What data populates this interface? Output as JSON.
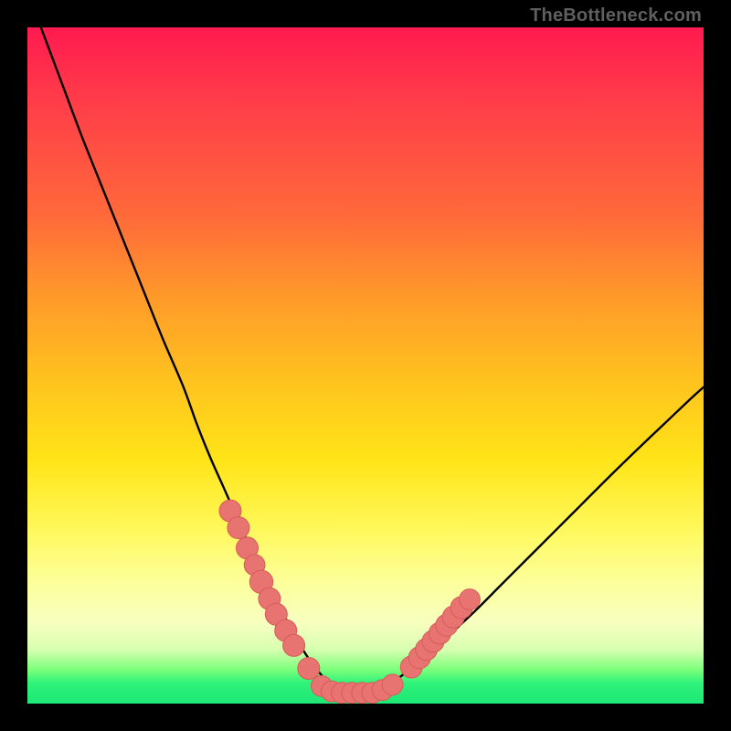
{
  "attribution": "TheBottleneck.com",
  "colors": {
    "curve": "#000000",
    "scatter_fill": "#e77471",
    "scatter_stroke": "#d85b58",
    "frame": "#000000"
  },
  "chart_data": {
    "type": "line",
    "title": "",
    "xlabel": "",
    "ylabel": "",
    "xlim": [
      0,
      100
    ],
    "ylim": [
      0,
      100
    ],
    "grid": false,
    "legend": false,
    "series": [
      {
        "name": "bottleneck-curve",
        "x": [
          2,
          5,
          8,
          11,
          14,
          17,
          20,
          23,
          25,
          27,
          29,
          31,
          33,
          35,
          37,
          38.5,
          40,
          41.5,
          43,
          45,
          47,
          50,
          53,
          56,
          59,
          62,
          66,
          70,
          74,
          78,
          82,
          86,
          90,
          94,
          98,
          100
        ],
        "values": [
          100,
          92,
          84,
          76.5,
          69,
          61.5,
          54,
          47,
          41.5,
          36.5,
          32,
          27.5,
          23,
          19,
          15,
          12,
          9.2,
          6.8,
          4.8,
          2.6,
          1.6,
          1.6,
          2.6,
          4.6,
          7.0,
          9.8,
          13.5,
          17.5,
          21.5,
          25.5,
          29.5,
          33.5,
          37.4,
          41.2,
          45.0,
          46.8
        ]
      }
    ],
    "scatter": {
      "name": "highlighted-points",
      "points": [
        {
          "x": 30.0,
          "y": 28.5,
          "r": 1.2
        },
        {
          "x": 31.2,
          "y": 26.0,
          "r": 1.2
        },
        {
          "x": 32.5,
          "y": 23.0,
          "r": 1.2
        },
        {
          "x": 33.6,
          "y": 20.5,
          "r": 1.1
        },
        {
          "x": 34.6,
          "y": 18.0,
          "r": 1.3
        },
        {
          "x": 35.8,
          "y": 15.5,
          "r": 1.2
        },
        {
          "x": 36.8,
          "y": 13.2,
          "r": 1.2
        },
        {
          "x": 38.2,
          "y": 10.8,
          "r": 1.2
        },
        {
          "x": 39.4,
          "y": 8.6,
          "r": 1.2
        },
        {
          "x": 41.6,
          "y": 5.2,
          "r": 1.2
        },
        {
          "x": 43.5,
          "y": 2.6,
          "r": 1.1
        },
        {
          "x": 45.0,
          "y": 1.8,
          "r": 1.1
        },
        {
          "x": 46.5,
          "y": 1.6,
          "r": 1.1
        },
        {
          "x": 48.0,
          "y": 1.6,
          "r": 1.1
        },
        {
          "x": 49.5,
          "y": 1.6,
          "r": 1.1
        },
        {
          "x": 51.0,
          "y": 1.6,
          "r": 1.1
        },
        {
          "x": 52.5,
          "y": 2.0,
          "r": 1.1
        },
        {
          "x": 54.0,
          "y": 2.8,
          "r": 1.1
        },
        {
          "x": 56.8,
          "y": 5.4,
          "r": 1.2
        },
        {
          "x": 58.0,
          "y": 6.8,
          "r": 1.2
        },
        {
          "x": 59.0,
          "y": 8.0,
          "r": 1.2
        },
        {
          "x": 60.0,
          "y": 9.2,
          "r": 1.2
        },
        {
          "x": 61.0,
          "y": 10.4,
          "r": 1.2
        },
        {
          "x": 62.0,
          "y": 11.6,
          "r": 1.2
        },
        {
          "x": 63.0,
          "y": 12.8,
          "r": 1.2
        },
        {
          "x": 64.2,
          "y": 14.2,
          "r": 1.2
        },
        {
          "x": 65.4,
          "y": 15.4,
          "r": 1.1
        }
      ]
    }
  }
}
